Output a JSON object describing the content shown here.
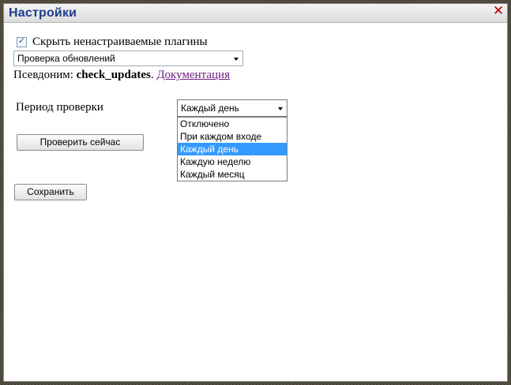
{
  "dialog": {
    "title": "Настройки",
    "close_glyph": "✕"
  },
  "hide_plugins": {
    "checked": true,
    "check_glyph": "✓",
    "label": "Скрыть ненастраиваемые плагины"
  },
  "plugin_select": {
    "selected": "Проверка обновлений"
  },
  "alias": {
    "prefix": "Псевдоним: ",
    "value": "check_updates",
    "separator": ". ",
    "docs_link": "Документация"
  },
  "period": {
    "label": "Период проверки",
    "selected": "Каждый день",
    "dropdown_open": true,
    "options": [
      "Отключено",
      "При каждом входе",
      "Каждый день",
      "Каждую неделю",
      "Каждый месяц"
    ],
    "highlighted_index": 2
  },
  "buttons": {
    "check_now": "Проверить сейчас",
    "save": "Сохранить"
  },
  "colors": {
    "title": "#1c3d8c",
    "close": "#b00000",
    "link": "#6a1b7d",
    "selection": "#3399ff"
  },
  "icons": {
    "close": "close-icon",
    "checkbox": "checkmark-icon",
    "dropdown_arrow": "chevron-down-icon"
  }
}
